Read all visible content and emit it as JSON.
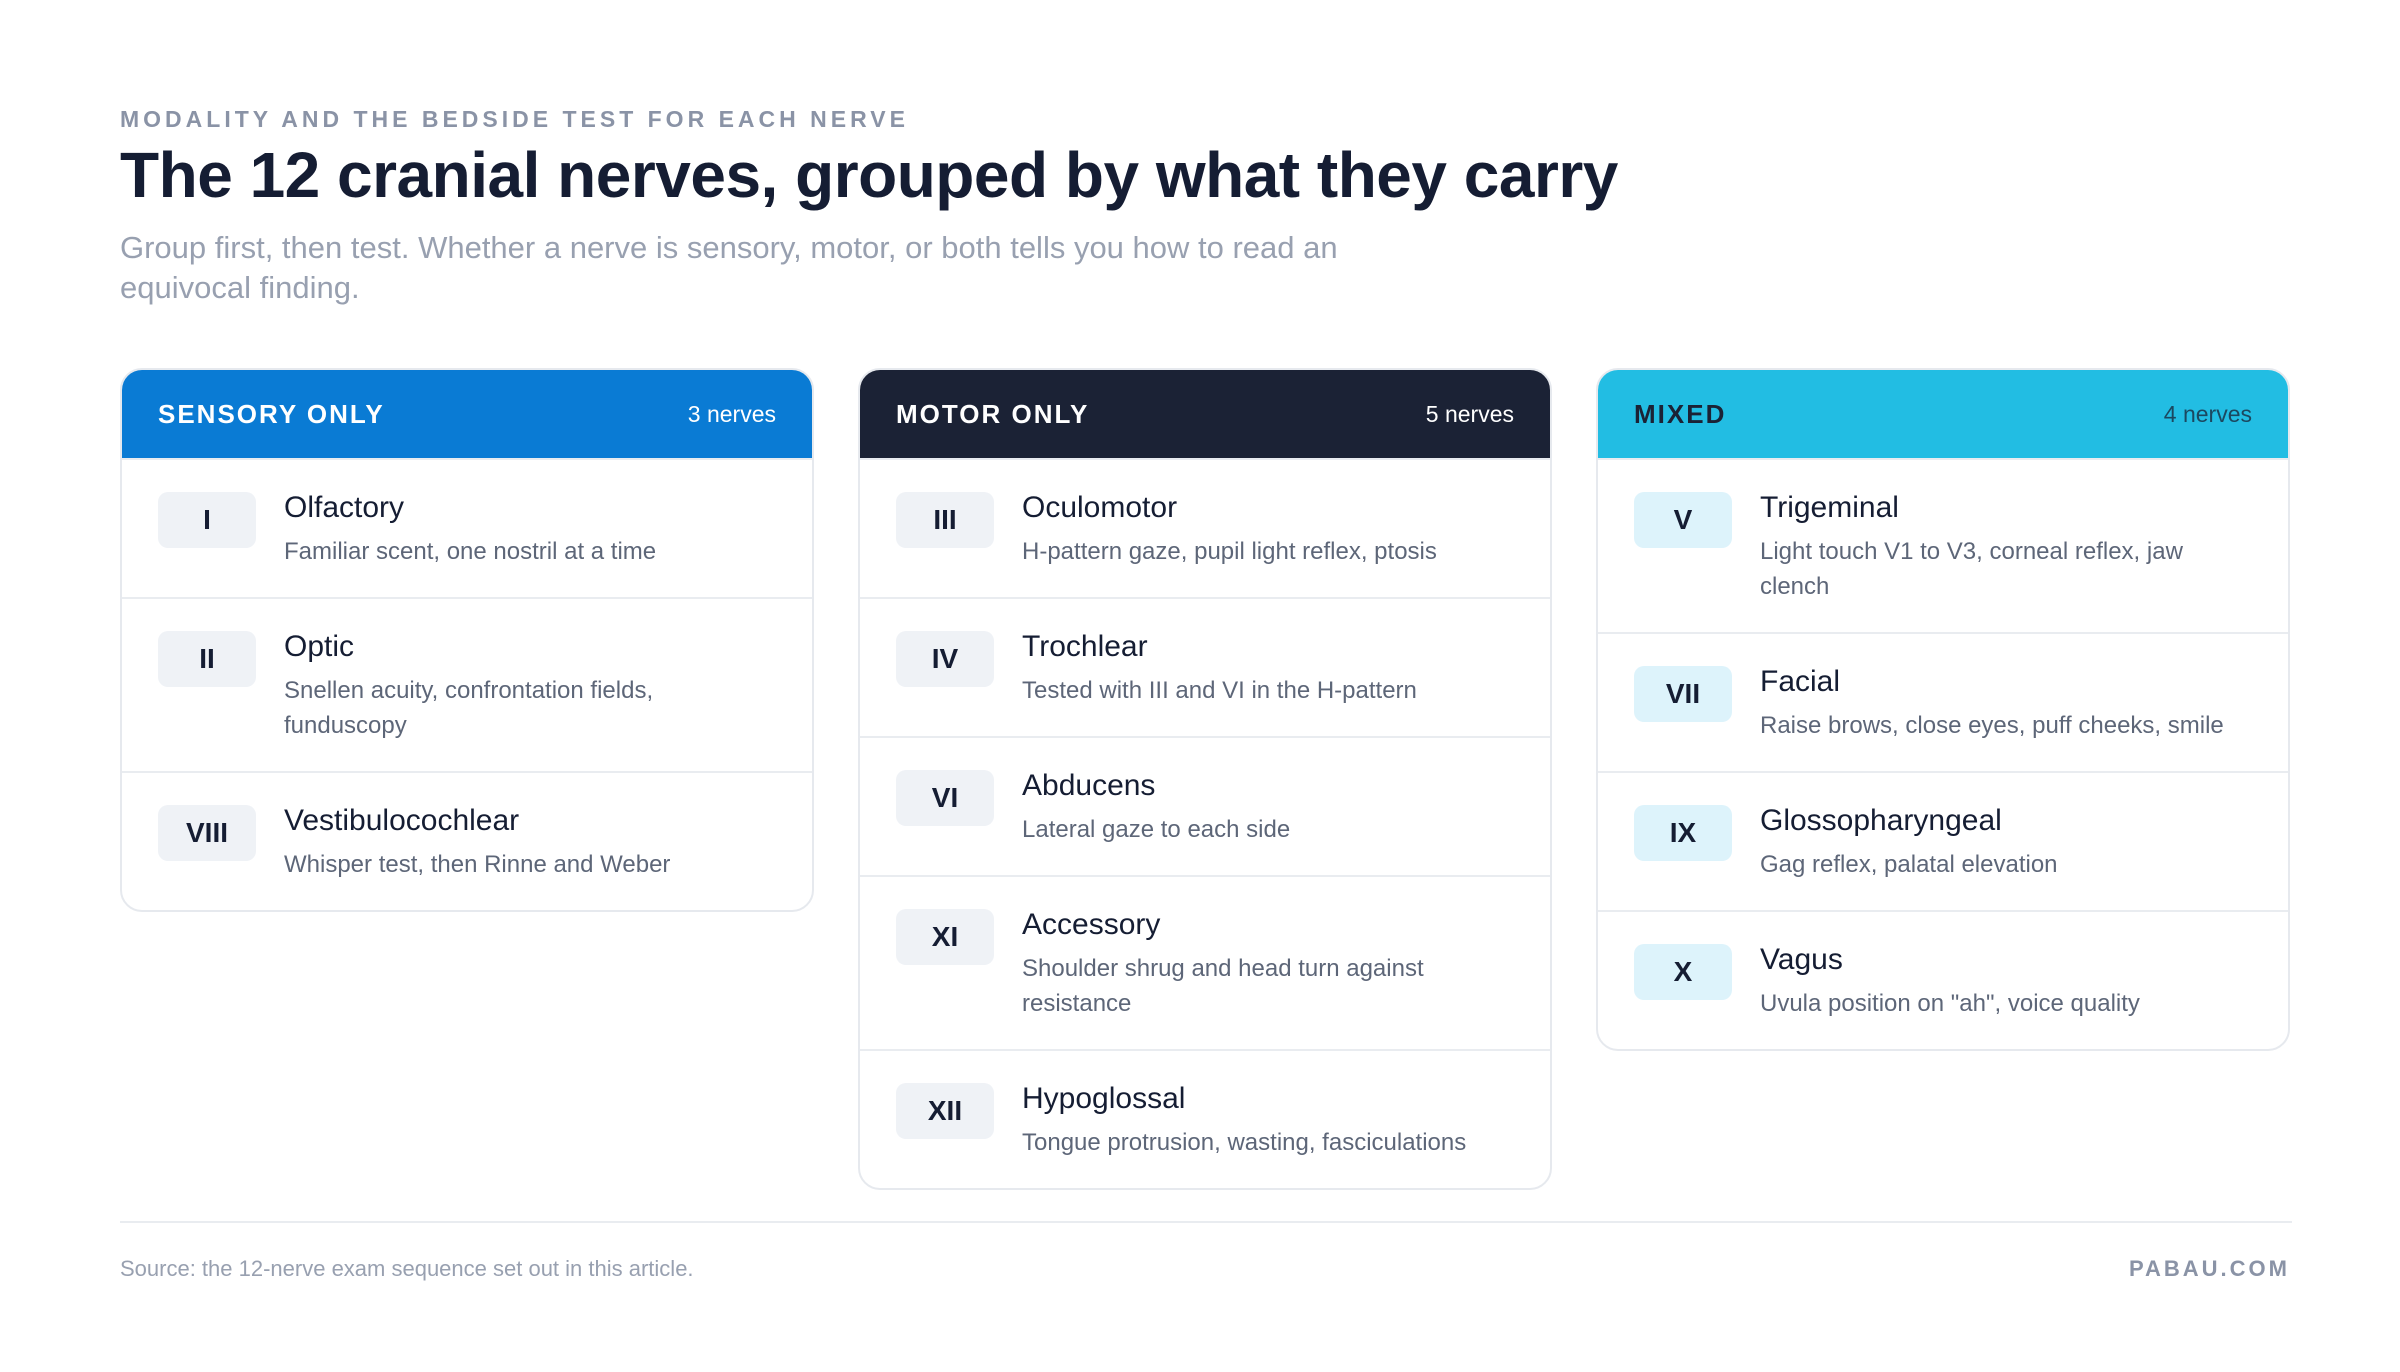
{
  "header": {
    "eyebrow": "MODALITY AND THE BEDSIDE TEST FOR EACH NERVE",
    "title": "The 12 cranial nerves, grouped by what they carry",
    "subtitle": "Group first, then test. Whether a nerve is sensory, motor, or both tells you how to read an equivocal finding."
  },
  "colors": {
    "sensory": "#0a7bd4",
    "motor": "#1b2235",
    "mixed": "#22bde3"
  },
  "groups": [
    {
      "name": "SENSORY ONLY",
      "count": "3 nerves",
      "nerves": [
        {
          "numeral": "I",
          "name": "Olfactory",
          "test": "Familiar scent, one nostril at a time"
        },
        {
          "numeral": "II",
          "name": "Optic",
          "test": "Snellen acuity, confrontation fields, funduscopy"
        },
        {
          "numeral": "VIII",
          "name": "Vestibulocochlear",
          "test": "Whisper test, then Rinne and Weber"
        }
      ]
    },
    {
      "name": "MOTOR ONLY",
      "count": "5 nerves",
      "nerves": [
        {
          "numeral": "III",
          "name": "Oculomotor",
          "test": "H-pattern gaze, pupil light reflex, ptosis"
        },
        {
          "numeral": "IV",
          "name": "Trochlear",
          "test": "Tested with III and VI in the H-pattern"
        },
        {
          "numeral": "VI",
          "name": "Abducens",
          "test": "Lateral gaze to each side"
        },
        {
          "numeral": "XI",
          "name": "Accessory",
          "test": "Shoulder shrug and head turn against resistance"
        },
        {
          "numeral": "XII",
          "name": "Hypoglossal",
          "test": "Tongue protrusion, wasting, fasciculations"
        }
      ]
    },
    {
      "name": "MIXED",
      "count": "4 nerves",
      "nerves": [
        {
          "numeral": "V",
          "name": "Trigeminal",
          "test": "Light touch V1 to V3, corneal reflex, jaw clench"
        },
        {
          "numeral": "VII",
          "name": "Facial",
          "test": "Raise brows, close eyes, puff cheeks, smile"
        },
        {
          "numeral": "IX",
          "name": "Glossopharyngeal",
          "test": "Gag reflex, palatal elevation"
        },
        {
          "numeral": "X",
          "name": "Vagus",
          "test": "Uvula position on \"ah\", voice quality"
        }
      ]
    }
  ],
  "footer": {
    "source": "Source: the 12-nerve exam sequence set out in this article.",
    "brand": "PABAU.COM"
  }
}
